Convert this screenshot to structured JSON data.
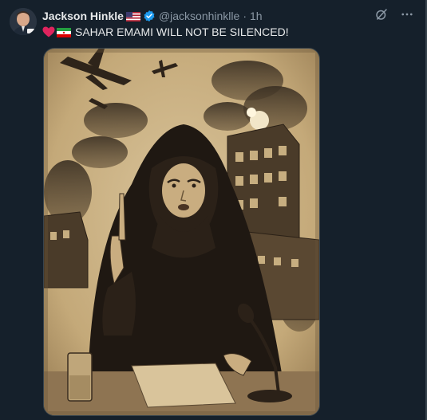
{
  "tweet": {
    "author_name": "Jackson Hinkle",
    "handle": "@jacksonhinklle",
    "separator": "·",
    "time": "1h",
    "text": "SAHAR EMAMI WILL NOT BE SILENCED!",
    "emojis": [
      "red-heart",
      "iran-flag"
    ],
    "name_flag": "us-flag",
    "verified": true
  },
  "colors": {
    "background": "#15202b",
    "text_primary": "#e7e9ea",
    "text_secondary": "#8b98a5",
    "verified_blue": "#1d9bf0",
    "sepia_light": "#d8c39a",
    "sepia_dark": "#2b2118"
  },
  "actions": [
    "grok-icon",
    "more-icon"
  ]
}
